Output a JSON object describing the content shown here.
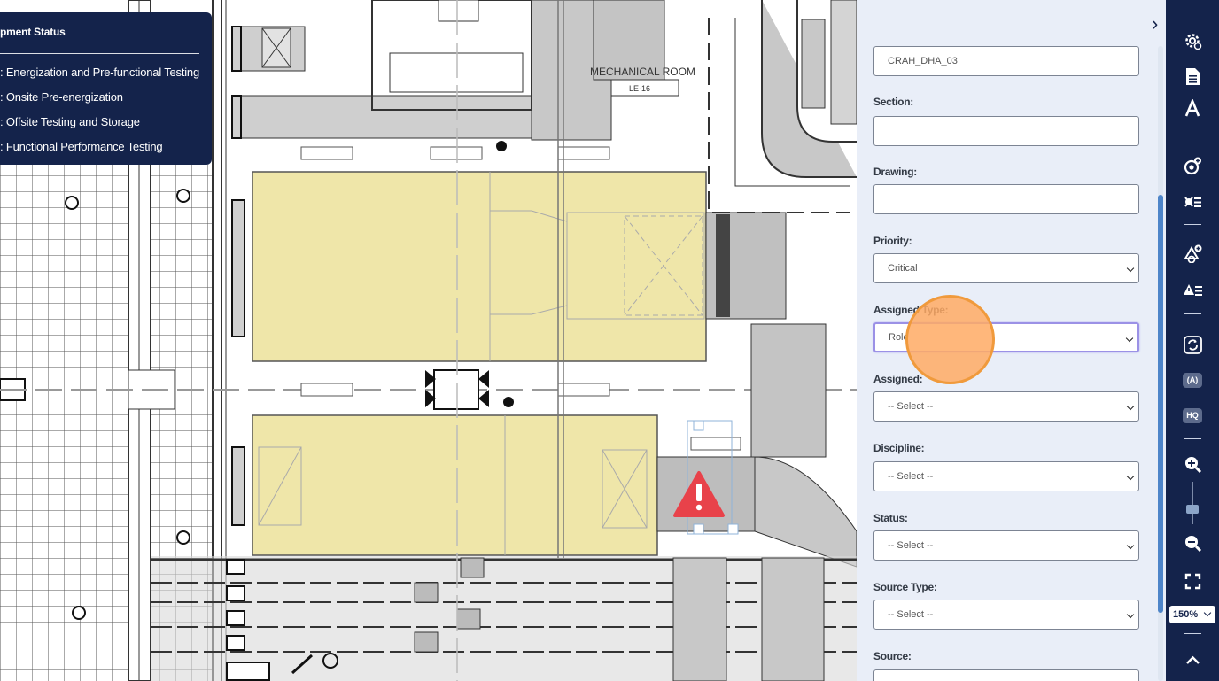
{
  "legend": {
    "title": "pment Status",
    "items": [
      ": Energization and Pre-functional Testing",
      ": Onsite Pre-energization",
      ": Offsite Testing and Storage",
      ": Functional Performance Testing"
    ]
  },
  "drawing": {
    "room_label": "MECHANICAL ROOM",
    "room_tag": "LE-16"
  },
  "form": {
    "name_value": "CRAH_DHA_03",
    "section_label": "Section:",
    "section_value": "",
    "drawing_label": "Drawing:",
    "drawing_value": "",
    "priority_label": "Priority:",
    "priority_value": "Critical",
    "assigned_type_label": "Assigned Type:",
    "assigned_type_value": "Role",
    "assigned_label": "Assigned:",
    "assigned_value": "-- Select --",
    "discipline_label": "Discipline:",
    "discipline_value": "-- Select --",
    "status_label": "Status:",
    "status_value": "-- Select --",
    "source_type_label": "Source Type:",
    "source_type_value": "-- Select --",
    "source_label": "Source:"
  },
  "toolbar": {
    "zoom_value": "150%",
    "badge_auto": "(A)",
    "badge_hq": "HQ",
    "icons": [
      "settings-gear-icon",
      "document-list-icon",
      "text-icon",
      "add-equipment-icon",
      "equipment-list-icon",
      "add-issue-icon",
      "issue-list-icon",
      "sync-icon",
      "auto-badge-icon",
      "hq-badge-icon",
      "zoom-in-icon",
      "zoom-slider",
      "zoom-out-icon",
      "fullscreen-icon",
      "zoom-level-select",
      "scroll-up-icon"
    ]
  },
  "colors": {
    "navy": "#14234b",
    "panel_bg": "#e9eef8",
    "highlight_yellow": "#efe6a9",
    "warning_red": "#e8424a",
    "cursor_orange": "#f09a3c",
    "scroll_blue": "#4e85c9"
  }
}
